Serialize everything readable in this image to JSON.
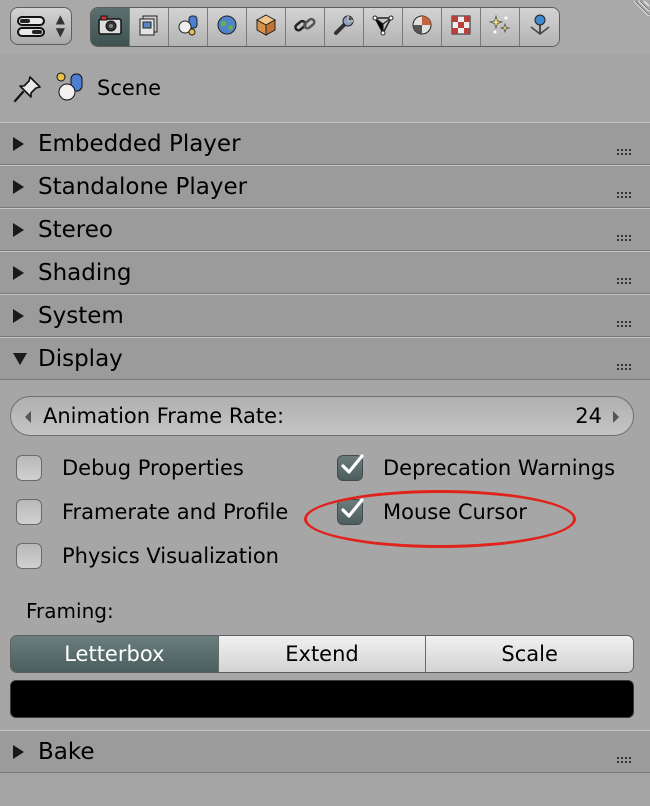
{
  "header": {
    "editor_type_icon": "properties-editor-icon",
    "tabs": [
      {
        "icon": "render-camera-icon",
        "active": true
      },
      {
        "icon": "render-layers-icon",
        "active": false
      },
      {
        "icon": "scene-icon",
        "active": false
      },
      {
        "icon": "world-icon",
        "active": false
      },
      {
        "icon": "object-cube-icon",
        "active": false
      },
      {
        "icon": "constraints-chain-icon",
        "active": false
      },
      {
        "icon": "modifiers-wrench-icon",
        "active": false
      },
      {
        "icon": "object-data-vertex-icon",
        "active": false
      },
      {
        "icon": "material-sphere-icon",
        "active": false
      },
      {
        "icon": "texture-checker-icon",
        "active": false
      },
      {
        "icon": "particles-icon",
        "active": false
      },
      {
        "icon": "physics-icon",
        "active": false
      }
    ]
  },
  "context": {
    "label": "Scene"
  },
  "panels": [
    {
      "title": "Embedded Player",
      "expanded": false
    },
    {
      "title": "Standalone Player",
      "expanded": false
    },
    {
      "title": "Stereo",
      "expanded": false
    },
    {
      "title": "Shading",
      "expanded": false
    },
    {
      "title": "System",
      "expanded": false
    },
    {
      "title": "Display",
      "expanded": true
    },
    {
      "title": "Bake",
      "expanded": false
    }
  ],
  "display": {
    "frame_rate": {
      "label": "Animation Frame Rate:",
      "value": "24"
    },
    "checkboxes": [
      {
        "label": "Debug Properties",
        "checked": false
      },
      {
        "label": "Deprecation Warnings",
        "checked": true
      },
      {
        "label": "Framerate and Profile",
        "checked": false
      },
      {
        "label": "Mouse Cursor",
        "checked": true
      },
      {
        "label": "Physics Visualization",
        "checked": false
      }
    ],
    "framing_label": "Framing:",
    "framing_options": [
      "Letterbox",
      "Extend",
      "Scale"
    ],
    "framing_selected": "Letterbox",
    "framing_color": "#000000"
  },
  "annotation": {
    "color": "#e0231b",
    "target": "Mouse Cursor"
  }
}
